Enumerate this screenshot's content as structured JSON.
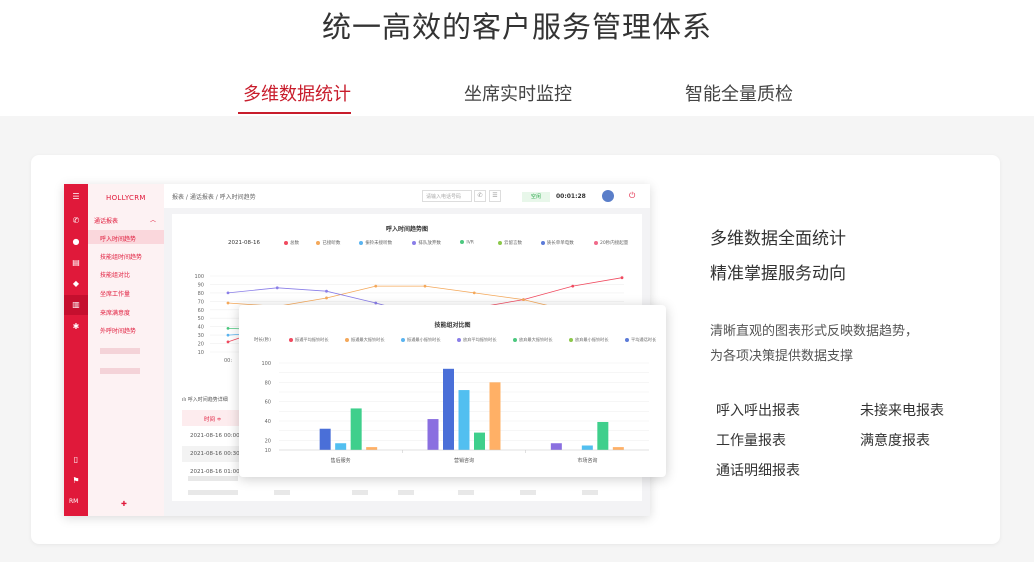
{
  "page": {
    "title": "统一高效的客户服务管理体系"
  },
  "tabs": [
    {
      "label": "多维数据统计",
      "active": true
    },
    {
      "label": "坐席实时监控",
      "active": false
    },
    {
      "label": "智能全量质检",
      "active": false
    }
  ],
  "colors": {
    "accent": "#c81d2c",
    "app_red": "#e0193a"
  },
  "app": {
    "brand": "HOLLYCRM",
    "rail_icons": [
      "menu-icon",
      "phone-icon",
      "user-icon",
      "clipboard-icon",
      "shield-icon",
      "chart-icon",
      "gear-icon",
      "book-icon",
      "flag-icon"
    ],
    "rail_label": "RM",
    "sidebar": {
      "group": "通话报表",
      "items": [
        "呼入时间趋势",
        "技能组时间趋势",
        "技能组对比",
        "坐席工作量",
        "来席满意度",
        "外呼时间趋势"
      ],
      "bottom_glyph": "✚"
    },
    "header": {
      "breadcrumb": "报表  /  通话报表  /  呼入时间趋势",
      "search_placeholder": "请输入电话号码",
      "call_glyph": "✆",
      "doc_glyph": "☰",
      "status": "空闲",
      "timer": "00:01:28",
      "power_glyph": "⏻"
    },
    "table": {
      "label": "呼入时间趋势详细",
      "header": "时间 ≑",
      "rows": [
        "2021-08-16 00:00",
        "2021-08-16 00:30",
        "2021-08-16 01:00"
      ]
    }
  },
  "chart_data": [
    {
      "type": "line",
      "title": "呼入时间趋势图",
      "date": "2021-08-16",
      "x_first_tick": "00:",
      "ylim": [
        10,
        100
      ],
      "yticks": [
        10,
        20,
        30,
        40,
        50,
        60,
        70,
        80,
        90,
        100
      ],
      "legend_position": "top",
      "series": [
        {
          "name": "总数",
          "color": "#f04a5f",
          "values": [
            22,
            42,
            55,
            58,
            60,
            62,
            72,
            88,
            98
          ]
        },
        {
          "name": "已接听数",
          "color": "#f4a85a",
          "values": [
            68,
            64,
            74,
            88,
            88,
            80,
            72,
            58,
            48
          ]
        },
        {
          "name": "振铃未接听数",
          "color": "#5ab4f0",
          "values": [
            30,
            34,
            42,
            50,
            50,
            48,
            52,
            58,
            62
          ]
        },
        {
          "name": "排队放弃数",
          "color": "#8a7ee8",
          "values": [
            80,
            86,
            82,
            68,
            52,
            40,
            48,
            58,
            60
          ]
        },
        {
          "name": "IVR",
          "color": "#4cc87f",
          "values": [
            38,
            36,
            38,
            44,
            48,
            50,
            55,
            54,
            50
          ]
        },
        {
          "name": "云留言数",
          "color": "#8cc84b",
          "values": []
        },
        {
          "name": "质长单单电数",
          "color": "#5c7bd8",
          "values": []
        },
        {
          "name": "20秒内接起量",
          "color": "#f06a8a",
          "values": []
        }
      ]
    },
    {
      "type": "bar",
      "title": "技能组对比图",
      "unit": "时长(秒)",
      "categories": [
        "售后服务",
        "营销咨询",
        "市场咨询"
      ],
      "ylim": [
        10,
        100
      ],
      "yticks": [
        10,
        20,
        30,
        40,
        50,
        60,
        70,
        80,
        90,
        100
      ],
      "legend_position": "top",
      "series": [
        {
          "name": "振通平均振铃时长",
          "color": "#8a6fe0",
          "values": [
            10,
            42,
            17
          ]
        },
        {
          "name": "振通最大振铃时长",
          "color": "#4a6fd8",
          "values": [
            32,
            94,
            10
          ]
        },
        {
          "name": "振通最小振铃时长",
          "color": "#52bff0",
          "values": [
            17,
            72,
            5
          ]
        },
        {
          "name": "放弃平均振铃时长",
          "color": "#3fcf8c",
          "values": [
            53,
            28,
            39
          ]
        },
        {
          "name": "放弃最大振铃时长",
          "color": "#ffb066",
          "values": [
            13,
            80,
            13
          ]
        }
      ],
      "legend": [
        {
          "name": "振通平均振铃时长",
          "color": "#f04a5f"
        },
        {
          "name": "振通最大振铃时长",
          "color": "#f4a85a"
        },
        {
          "name": "振通最小振铃时长",
          "color": "#5ab4f0"
        },
        {
          "name": "放弃平均振铃时长",
          "color": "#8a7ee8"
        },
        {
          "name": "放弃最大振铃时长",
          "color": "#4cc87f"
        },
        {
          "name": "放弃最小振铃时长",
          "color": "#8cc84b"
        },
        {
          "name": "平均通话时长",
          "color": "#5c7bd8"
        }
      ]
    }
  ],
  "right": {
    "title1": "多维数据全面统计",
    "title2": "精准掌握服务动向",
    "desc1": "清晰直观的图表形式反映数据趋势，",
    "desc2": "为各项决策提供数据支撑",
    "reports": [
      "呼入呼出报表",
      "未接来电报表",
      "工作量报表",
      "满意度报表",
      "通话明细报表"
    ]
  }
}
